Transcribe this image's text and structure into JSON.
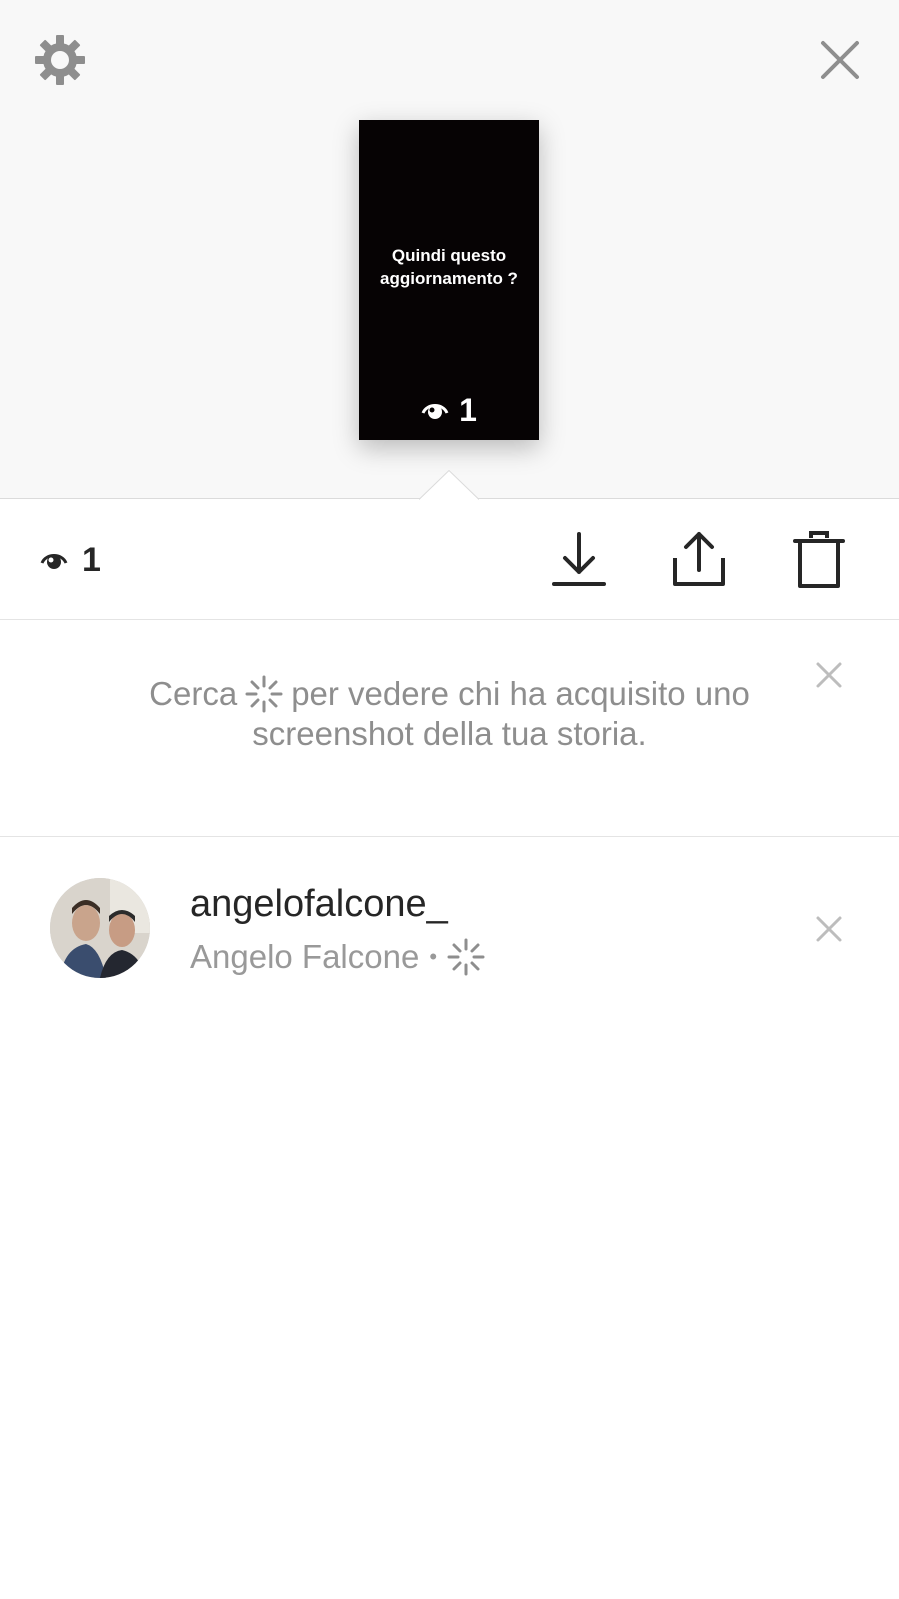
{
  "story": {
    "caption": "Quindi questo aggiornamento ?",
    "view_count": "1"
  },
  "actions": {
    "view_count": "1",
    "icons": [
      "download-icon",
      "share-icon",
      "trash-icon"
    ]
  },
  "info_banner": {
    "text_before": "Cerca",
    "text_after": "per vedere chi ha acquisito uno screenshot della tua storia."
  },
  "viewers": [
    {
      "username": "angelofalcone_",
      "full_name": "Angelo Falcone",
      "separator": "•"
    }
  ],
  "colors": {
    "top_bg": "#f8f8f8",
    "icon_gray": "#8e8e8e",
    "text_dark": "#262626",
    "story_bg": "#060304"
  }
}
